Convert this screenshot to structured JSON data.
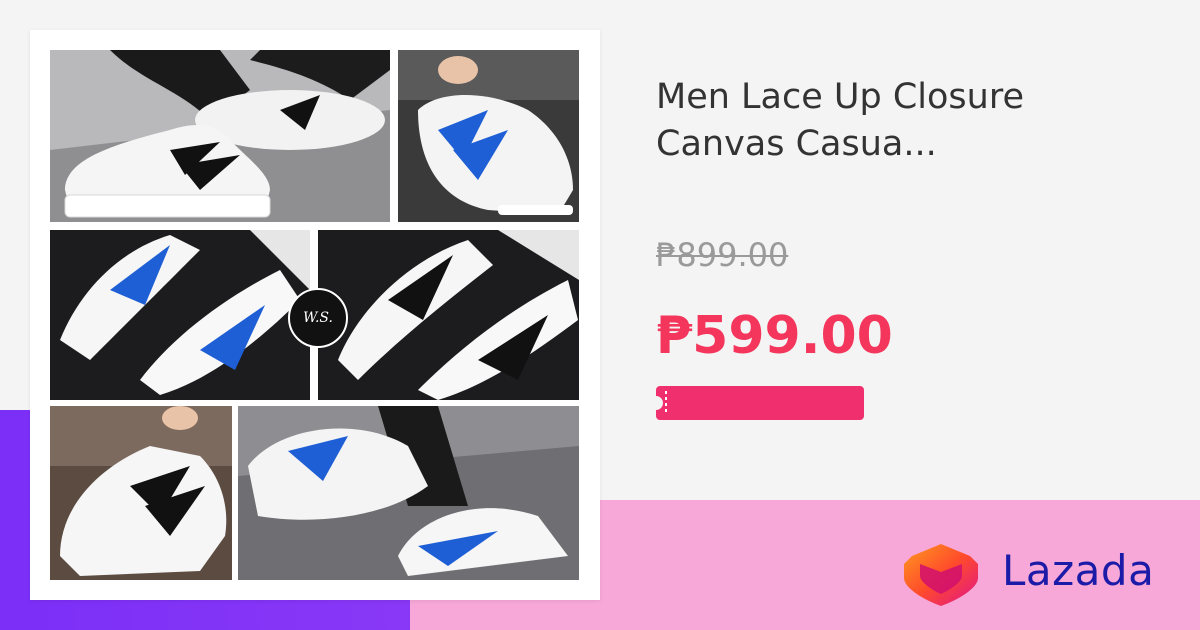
{
  "product": {
    "title_line1": "Men Lace Up Closure",
    "title_line2": "Canvas Casua...",
    "original_price": "₱899.00",
    "sale_price": "₱599.00"
  },
  "collage": {
    "center_badge": "W.S."
  },
  "brand": {
    "name": "Lazada"
  },
  "colors": {
    "price_accent": "#f5365c",
    "voucher": "#f0306e",
    "brand_text": "#1b1ba8",
    "purple_band": "#7b2ff7",
    "pink_band": "#f7a8d8"
  }
}
